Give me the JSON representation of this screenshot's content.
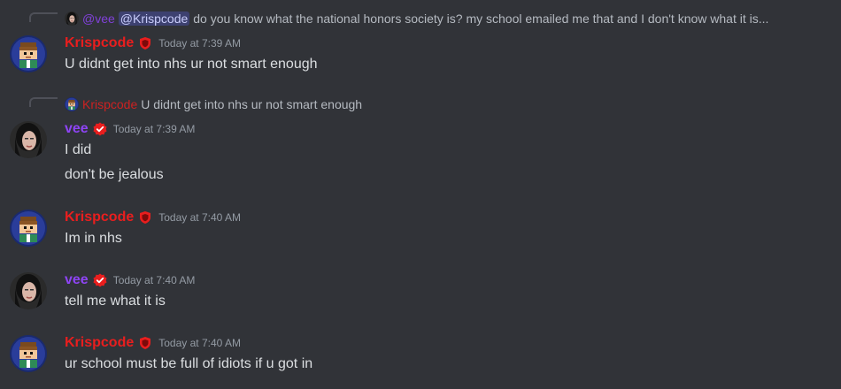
{
  "colors": {
    "krisp": "#e91e1e",
    "vee": "#8e44f5",
    "bg": "#313338"
  },
  "messages": [
    {
      "reply": {
        "name": "@vee",
        "mention": "@Krispcode",
        "text": "do you know what the national honors society is? my school emailed me that and I don't know what it is..."
      },
      "author": "Krispcode",
      "timestamp": "Today at 7:39 AM",
      "lines": [
        "U didnt get into nhs ur not smart enough"
      ]
    },
    {
      "reply": {
        "name": "Krispcode",
        "text": "U didnt get into nhs ur not smart enough"
      },
      "author": "vee",
      "timestamp": "Today at 7:39 AM",
      "lines": [
        "I did",
        "don't be jealous"
      ]
    },
    {
      "author": "Krispcode",
      "timestamp": "Today at 7:40 AM",
      "lines": [
        "Im in nhs"
      ]
    },
    {
      "author": "vee",
      "timestamp": "Today at 7:40 AM",
      "lines": [
        "tell me what it is"
      ]
    },
    {
      "author": "Krispcode",
      "timestamp": "Today at 7:40 AM",
      "lines": [
        "ur school must be full of idiots if u got in"
      ]
    }
  ]
}
